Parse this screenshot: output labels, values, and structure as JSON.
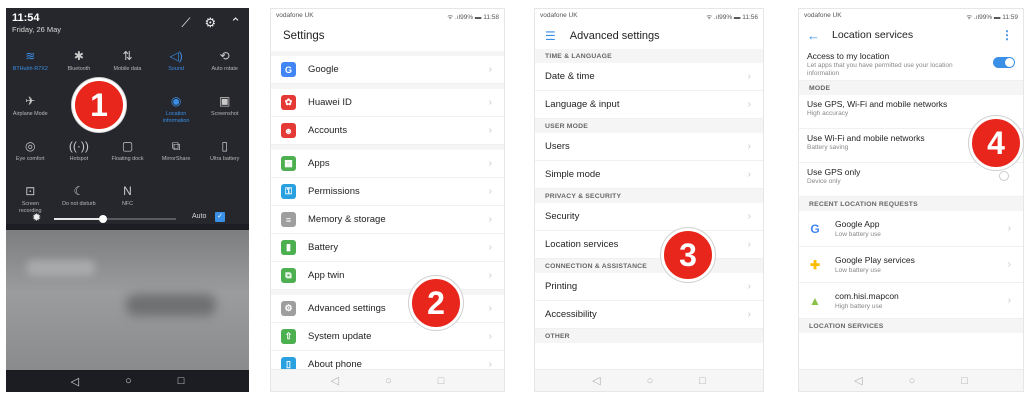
{
  "panel1": {
    "time": "11:54",
    "date": "Friday, 26 May",
    "top_icons": [
      "edit-icon",
      "gear-icon",
      "chevron-up-icon"
    ],
    "tiles": [
      {
        "name": "wifi",
        "label": "BTHubh-R7X2",
        "icon": "wifi-icon",
        "glyph": "≋",
        "on": true
      },
      {
        "name": "bluetooth",
        "label": "Bluetooth",
        "icon": "bluetooth-icon",
        "glyph": "✱",
        "on": false
      },
      {
        "name": "mobile-data",
        "label": "Mobile data",
        "icon": "mobile-data-icon",
        "glyph": "⇅",
        "on": false
      },
      {
        "name": "sound",
        "label": "Sound",
        "icon": "sound-icon",
        "glyph": "◁)",
        "on": true
      },
      {
        "name": "auto-rotate",
        "label": "Auto rotate",
        "icon": "rotate-icon",
        "glyph": "⟲",
        "on": false
      },
      {
        "name": "airplane-mode",
        "label": "Airplane Mode",
        "icon": "airplane-icon",
        "glyph": "✈",
        "on": false
      },
      {
        "name": "hidden-1",
        "label": "",
        "icon": "blank-icon",
        "glyph": "",
        "on": false
      },
      {
        "name": "hidden-2",
        "label": "",
        "icon": "blank-icon",
        "glyph": "",
        "on": false
      },
      {
        "name": "location-information",
        "label": "Location\ninformation",
        "icon": "location-icon",
        "glyph": "◉",
        "on": true
      },
      {
        "name": "screenshot",
        "label": "Screenshot",
        "icon": "screenshot-icon",
        "glyph": "▣",
        "on": false
      },
      {
        "name": "eye-comfort",
        "label": "Eye comfort",
        "icon": "eye-icon",
        "glyph": "◎",
        "on": false
      },
      {
        "name": "hotspot",
        "label": "Hotspot",
        "icon": "hotspot-icon",
        "glyph": "((·))",
        "on": false
      },
      {
        "name": "floating-dock",
        "label": "Floating dock",
        "icon": "dock-icon",
        "glyph": "▢",
        "on": false
      },
      {
        "name": "mirrorshare",
        "label": "MirrorShare",
        "icon": "mirrorshare-icon",
        "glyph": "⧉",
        "on": false
      },
      {
        "name": "ultra-battery",
        "label": "Ultra battery",
        "icon": "battery-icon",
        "glyph": "▯",
        "on": false
      },
      {
        "name": "screen-recording",
        "label": "Screen\nrecording",
        "icon": "record-icon",
        "glyph": "⊡",
        "on": false
      },
      {
        "name": "do-not-disturb",
        "label": "Do not disturb",
        "icon": "moon-icon",
        "glyph": "☾",
        "on": false
      },
      {
        "name": "nfc",
        "label": "NFC",
        "icon": "nfc-icon",
        "glyph": "N",
        "on": false
      },
      {
        "name": "empty-1",
        "label": "",
        "icon": "blank-icon",
        "glyph": "",
        "on": false
      },
      {
        "name": "empty-2",
        "label": "",
        "icon": "blank-icon",
        "glyph": "",
        "on": false
      }
    ],
    "brightness": {
      "level": 0.4,
      "auto_label": "Auto",
      "auto_checked": true
    }
  },
  "panel2": {
    "carrier": "vodafone UK",
    "status": "ᯤ .ıl99% ▬ 11:58",
    "title": "Settings",
    "groups": [
      [
        {
          "label": "Google",
          "icon": "google-icon",
          "glyph": "G",
          "color": "#4285f4"
        }
      ],
      [
        {
          "label": "Huawei ID",
          "icon": "huawei-icon",
          "glyph": "✿",
          "color": "#e53935"
        },
        {
          "label": "Accounts",
          "icon": "accounts-icon",
          "glyph": "☻",
          "color": "#e53935"
        }
      ],
      [
        {
          "label": "Apps",
          "icon": "apps-icon",
          "glyph": "▦",
          "color": "#4caf50"
        },
        {
          "label": "Permissions",
          "icon": "permissions-icon",
          "glyph": "⚿",
          "color": "#29a0e0"
        },
        {
          "label": "Memory & storage",
          "icon": "storage-icon",
          "glyph": "≡",
          "color": "#9e9e9e"
        },
        {
          "label": "Battery",
          "icon": "battery-icon",
          "glyph": "▮",
          "color": "#4caf50"
        },
        {
          "label": "App twin",
          "icon": "app-twin-icon",
          "glyph": "⧉",
          "color": "#4caf50"
        }
      ],
      [
        {
          "label": "Advanced settings",
          "icon": "advanced-settings-icon",
          "glyph": "⚙",
          "color": "#9e9e9e"
        },
        {
          "label": "System update",
          "icon": "system-update-icon",
          "glyph": "⇧",
          "color": "#4caf50"
        },
        {
          "label": "About phone",
          "icon": "about-phone-icon",
          "glyph": "▯",
          "color": "#29a0e0"
        }
      ]
    ]
  },
  "panel3": {
    "carrier": "vodafone UK",
    "status": "ᯤ .ıl99% ▬ 11:56",
    "title": "Advanced settings",
    "sections": [
      {
        "header": "TIME & LANGUAGE",
        "items": [
          "Date & time",
          "Language & input"
        ]
      },
      {
        "header": "USER MODE",
        "items": [
          "Users",
          "Simple mode"
        ]
      },
      {
        "header": "PRIVACY & SECURITY",
        "items": [
          "Security",
          "Location services"
        ]
      },
      {
        "header": "CONNECTION & ASSISTANCE",
        "items": [
          "Printing",
          "Accessibility"
        ]
      },
      {
        "header": "OTHER",
        "items": []
      }
    ]
  },
  "panel4": {
    "carrier": "vodafone UK",
    "status": "ᯤ .ıl99% ▬ 11:59",
    "title": "Location services",
    "access": {
      "title": "Access to my location",
      "subtitle": "Let apps that you have permitted use your location information",
      "enabled": true
    },
    "mode_header": "MODE",
    "modes": [
      {
        "title": "Use GPS, Wi-Fi and mobile networks",
        "subtitle": "High accuracy"
      },
      {
        "title": "Use Wi-Fi and mobile networks",
        "subtitle": "Battery saving"
      },
      {
        "title": "Use GPS only",
        "subtitle": "Device only"
      }
    ],
    "recent_header": "RECENT LOCATION REQUESTS",
    "recent": [
      {
        "title": "Google App",
        "subtitle": "Low battery use",
        "icon": "google-app-icon",
        "glyph": "G",
        "color": "#4285f4"
      },
      {
        "title": "Google Play services",
        "subtitle": "Low battery use",
        "icon": "play-services-icon",
        "glyph": "✚",
        "color": "#fbbc05"
      },
      {
        "title": "com.hisi.mapcon",
        "subtitle": "High battery use",
        "icon": "android-icon",
        "glyph": "▲",
        "color": "#8bc34a"
      }
    ],
    "services_header": "LOCATION SERVICES"
  },
  "badges": [
    "1",
    "2",
    "3",
    "4"
  ],
  "colors": {
    "accent": "#3a8fe6",
    "badge": "#e8261b"
  }
}
